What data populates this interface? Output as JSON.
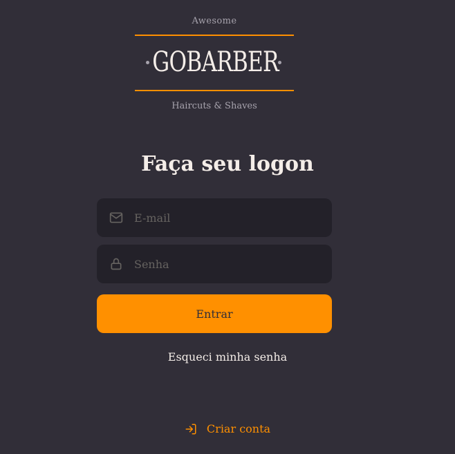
{
  "logo": {
    "top_text": "Awesome",
    "wordmark": "GOBARBER",
    "bottom_text": "Haircuts & Shaves"
  },
  "form": {
    "title": "Faça seu logon",
    "email_placeholder": "E-mail",
    "password_placeholder": "Senha",
    "submit_label": "Entrar",
    "forgot_label": "Esqueci minha senha"
  },
  "footer": {
    "create_account_label": "Criar conta"
  },
  "icons": {
    "email": "mail-icon",
    "password": "lock-icon",
    "create_account": "log-in-icon"
  },
  "colors": {
    "background": "#312e38",
    "input_background": "#232129",
    "accent": "#ff9000",
    "text": "#f4ede8",
    "placeholder": "#666360",
    "muted": "#a7a3ad"
  }
}
